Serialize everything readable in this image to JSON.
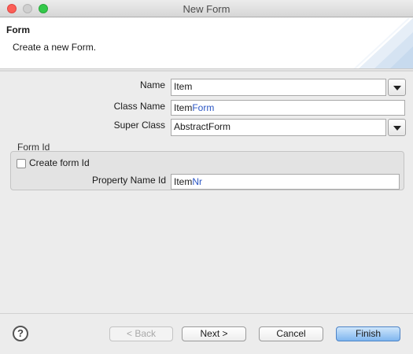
{
  "window": {
    "title": "New Form"
  },
  "header": {
    "title": "Form",
    "description": "Create a new Form."
  },
  "fields": {
    "name": {
      "label": "Name",
      "value": "Item"
    },
    "class_name": {
      "label": "Class Name",
      "value_prefix": "Item",
      "value_suffix": "Form"
    },
    "super_class": {
      "label": "Super Class",
      "value": "AbstractForm"
    }
  },
  "form_id_group": {
    "label": "Form Id",
    "checkbox_label": "Create form Id",
    "checkbox_checked": false,
    "property": {
      "label": "Property Name Id",
      "value_prefix": "Item",
      "value_suffix": "Nr"
    }
  },
  "footer": {
    "help_icon": "?",
    "back_label": "< Back",
    "next_label": "Next >",
    "cancel_label": "Cancel",
    "finish_label": "Finish"
  },
  "colors": {
    "highlight_text": "#2a55c4",
    "default_button": "#7fb6ef"
  }
}
